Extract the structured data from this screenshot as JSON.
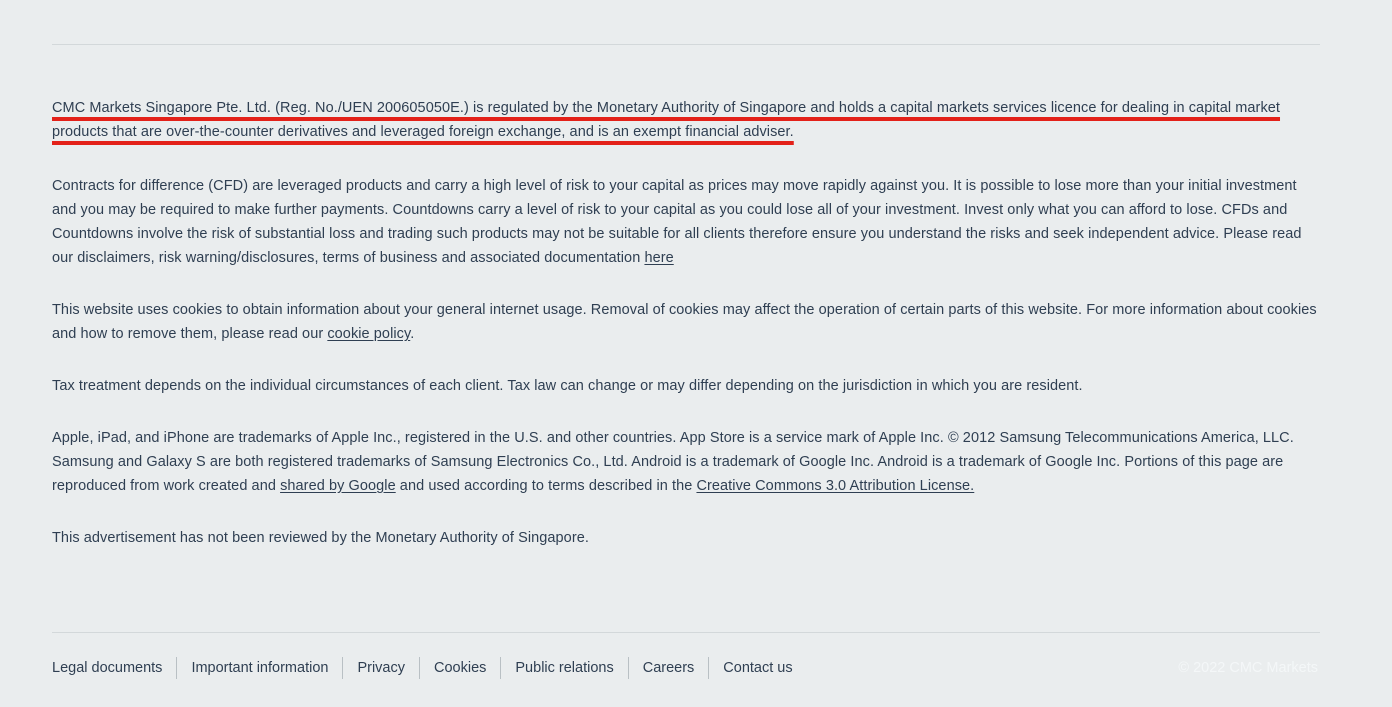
{
  "page": {
    "background_color": "#eaedee",
    "text_color": "#2f3f52",
    "highlight_color": "#e32119",
    "divider_color": "#d3d8da"
  },
  "disclaimer": {
    "regulatory_notice": {
      "text": "CMC Markets Singapore Pte. Ltd. (Reg. No./UEN 200605050E.) is regulated by the Monetary Authority of Singapore and holds a capital markets services licence for dealing in capital market products that are over-the-counter derivatives and leveraged foreign exchange, and is an exempt financial adviser.",
      "annotation": "red-underline"
    },
    "risk_warning": {
      "text_before_link": "Contracts for difference (CFD) are leveraged products and carry a high level of risk to your capital as prices may move rapidly against you. It is possible to lose more than your initial investment and you may be required to make further payments. Countdowns carry a level of risk to your capital as you could lose all of your investment. Invest only what you can afford to lose. CFDs and Countdowns involve the risk of substantial loss and trading such products may not be suitable for all clients therefore ensure you understand the risks and seek independent advice. Please read our disclaimers, risk warning/disclosures, terms of business and associated documentation ",
      "link_label": "here"
    },
    "cookie_notice": {
      "text_before_link": "This website uses cookies to obtain information about your general internet usage. Removal of cookies may affect the operation of certain parts of this website. For more information about cookies and how to remove them, please read our ",
      "link_label": "cookie policy",
      "text_after_link": "."
    },
    "tax_notice": {
      "text": "Tax treatment depends on the individual circumstances of each client. Tax law can change or may differ depending on the jurisdiction in which you are resident."
    },
    "trademark_notice": {
      "text_before_link1": "Apple, iPad, and iPhone are trademarks of Apple Inc., registered in the U.S. and other countries. App Store is a service mark of Apple Inc. © 2012 Samsung Telecommunications America, LLC. Samsung and Galaxy S are both registered trademarks of Samsung Electronics Co., Ltd. Android is a trademark of Google Inc. Android is a trademark of Google Inc. Portions of this page are reproduced from work created and ",
      "link1_label": "shared by Google",
      "text_between_links": " and used according to terms described in the ",
      "link2_label": "Creative Commons 3.0 Attribution License."
    },
    "advertisement_notice": {
      "text": "This advertisement has not been reviewed by the Monetary Authority of Singapore."
    }
  },
  "footer": {
    "links": [
      {
        "label": "Legal documents"
      },
      {
        "label": "Important information"
      },
      {
        "label": "Privacy"
      },
      {
        "label": "Cookies"
      },
      {
        "label": "Public relations"
      },
      {
        "label": "Careers"
      },
      {
        "label": "Contact us"
      }
    ],
    "copyright": "© 2022 CMC Markets"
  }
}
